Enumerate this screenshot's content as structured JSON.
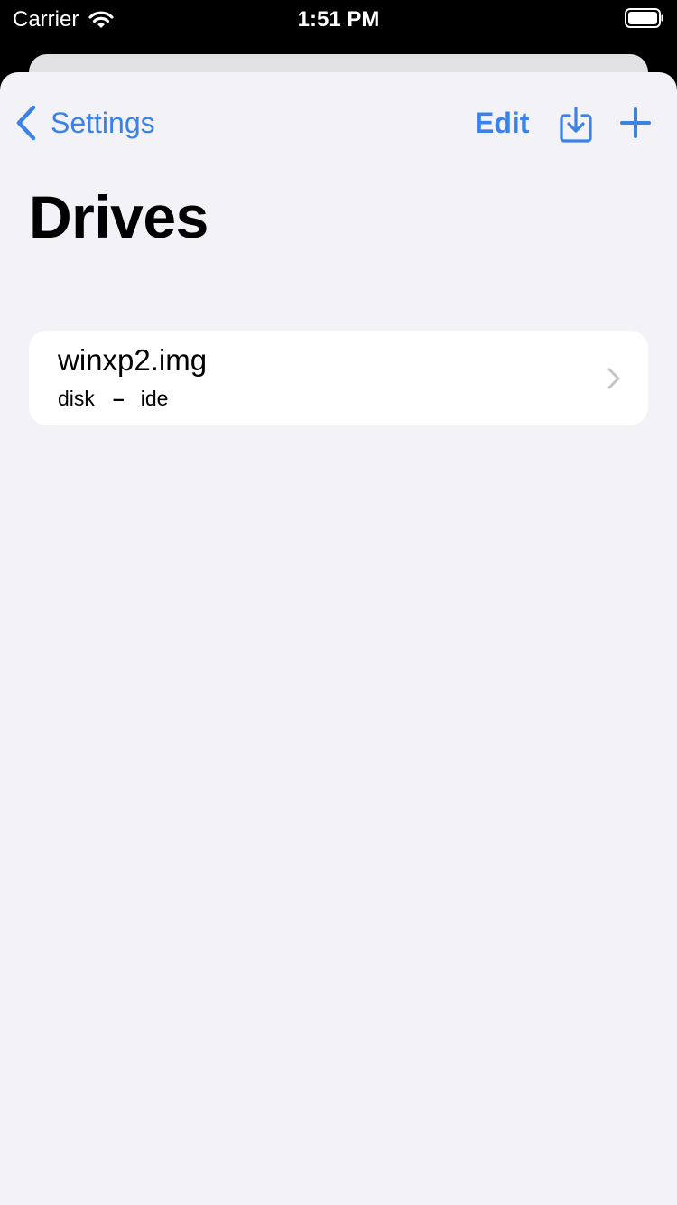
{
  "status_bar": {
    "carrier": "Carrier",
    "time": "1:51 PM",
    "icons": [
      "wifi-icon",
      "battery-icon"
    ]
  },
  "nav": {
    "back_label": "Settings",
    "edit_label": "Edit",
    "icons": [
      "chevron-left-icon",
      "import-icon",
      "plus-icon"
    ]
  },
  "title": "Drives",
  "drives": [
    {
      "name": "winxp2.img",
      "type": "disk",
      "separator": "–",
      "interface": "ide"
    }
  ],
  "colors": {
    "accent": "#3b82e8",
    "background": "#f2f2f7",
    "card": "#ffffff",
    "chevron": "#c4c4c7"
  }
}
